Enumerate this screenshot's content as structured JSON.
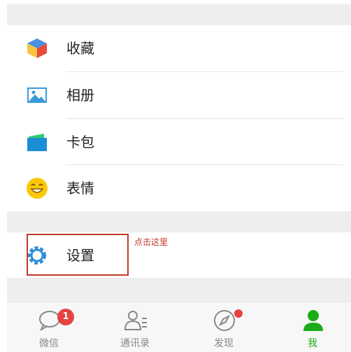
{
  "menu": {
    "items": [
      {
        "label": "收藏",
        "icon": "favorites-cube-icon"
      },
      {
        "label": "相册",
        "icon": "album-picture-icon"
      },
      {
        "label": "卡包",
        "icon": "card-wallet-icon"
      },
      {
        "label": "表情",
        "icon": "smiley-face-icon"
      }
    ],
    "settings": {
      "label": "设置",
      "icon": "gear-icon"
    }
  },
  "annotation": {
    "text": "点击这里",
    "color": "#c0392b"
  },
  "tabbar": {
    "tabs": [
      {
        "label": "微信",
        "icon": "chat-bubble-icon",
        "badge": "1"
      },
      {
        "label": "通讯录",
        "icon": "contacts-icon"
      },
      {
        "label": "发现",
        "icon": "compass-icon",
        "dot": true
      },
      {
        "label": "我",
        "icon": "person-icon",
        "active": true
      }
    ]
  },
  "colors": {
    "accent": "#1aad19",
    "badge": "#e64340",
    "background_gap": "#eeeeee"
  }
}
